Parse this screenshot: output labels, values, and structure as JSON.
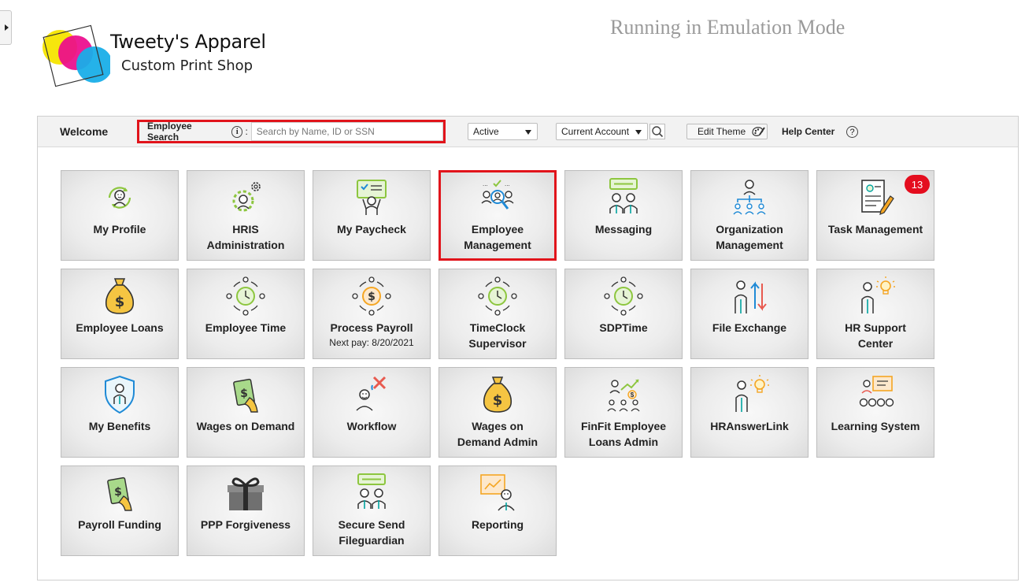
{
  "brand": {
    "name": "Tweety's Apparel",
    "tagline": "Custom Print Shop"
  },
  "emulation_text": "Running in Emulation Mode",
  "toolbar": {
    "welcome": "Welcome",
    "search_label": "Employee Search",
    "search_info": "i",
    "search_colon": ":",
    "search_placeholder": "Search by Name, ID or SSN",
    "status_value": "Active",
    "account_value": "Current Account",
    "edit_theme": "Edit Theme",
    "help_center": "Help Center",
    "help_icon": "?"
  },
  "colors": {
    "accent_green": "#8dc63f",
    "accent_teal": "#00a3a0",
    "accent_blue": "#1f8ad6",
    "accent_orange": "#f5a623",
    "highlight_red": "#e1141b",
    "badge_red": "#e40d1e"
  },
  "tiles": [
    {
      "label": "My Profile",
      "icon": "profile-icon"
    },
    {
      "label": "HRIS Administration",
      "icon": "gear-person-icon"
    },
    {
      "label": "My Paycheck",
      "icon": "paycheck-icon"
    },
    {
      "label": "Employee Management",
      "icon": "employee-management-icon",
      "selected": true
    },
    {
      "label": "Messaging",
      "icon": "messaging-icon"
    },
    {
      "label": "Organization Management",
      "icon": "org-chart-icon"
    },
    {
      "label": "Task Management",
      "icon": "task-document-icon",
      "badge": "13"
    },
    {
      "label": "Employee Loans",
      "icon": "money-bag-icon"
    },
    {
      "label": "Employee Time",
      "icon": "clock-people-icon"
    },
    {
      "label": "Process Payroll",
      "sub": "Next pay: 8/20/2021",
      "icon": "payroll-cycle-icon"
    },
    {
      "label": "TimeClock Supervisor",
      "icon": "clock-people-icon"
    },
    {
      "label": "SDPTime",
      "icon": "clock-people-icon"
    },
    {
      "label": "File Exchange",
      "icon": "file-exchange-icon"
    },
    {
      "label": "HR Support Center",
      "icon": "lightbulb-person-icon"
    },
    {
      "label": "My Benefits",
      "icon": "shield-person-icon"
    },
    {
      "label": "Wages on Demand",
      "icon": "cash-hand-icon"
    },
    {
      "label": "Workflow",
      "icon": "workflow-tools-icon"
    },
    {
      "label": "Wages on Demand Admin",
      "icon": "money-bag-icon"
    },
    {
      "label": "FinFit Employee Loans Admin",
      "icon": "finance-growth-icon"
    },
    {
      "label": "HRAnswerLink",
      "icon": "lightbulb-person-icon"
    },
    {
      "label": "Learning System",
      "icon": "presentation-icon"
    },
    {
      "label": "Payroll Funding",
      "icon": "cash-hand-icon"
    },
    {
      "label": "PPP Forgiveness",
      "icon": "gift-icon"
    },
    {
      "label": "Secure Send Fileguardian",
      "icon": "messaging-icon"
    },
    {
      "label": "Reporting",
      "icon": "report-chart-icon"
    }
  ]
}
